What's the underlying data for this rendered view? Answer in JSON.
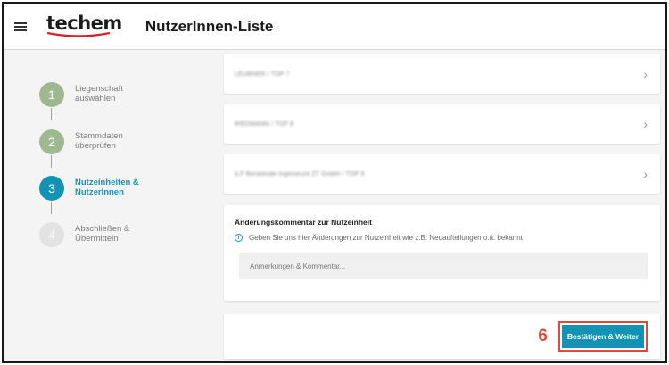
{
  "header": {
    "logo_text": "techem",
    "title": "NutzerInnen-Liste"
  },
  "steps": [
    {
      "number": "1",
      "label": "Liegenschaft auswählen",
      "state": "done"
    },
    {
      "number": "2",
      "label": "Stammdaten überprüfen",
      "state": "done"
    },
    {
      "number": "3",
      "label": "Nutzeinheiten & NutzerInnen",
      "state": "active"
    },
    {
      "number": "4",
      "label": "Abschließen & Übermitteln",
      "state": "todo"
    }
  ],
  "units": [
    {
      "name": "LEUBNER / TOP 7"
    },
    {
      "name": "RIEDMANN / TOP 8"
    },
    {
      "name": "ILF Beratende Ingenieure ZT GmbH / TOP 9"
    }
  ],
  "comment": {
    "title": "Änderungskommentar zur Nutzeinheit",
    "hint": "Geben Sie uns hier Änderungen zur Nutzeinheit wie z.B. Neuaufteilungen o.ä. bekannt",
    "placeholder": "Anmerkungen & Kommentar...",
    "value": ""
  },
  "footer": {
    "annotation_number": "6",
    "confirm_label": "Bestätigen & Weiter"
  },
  "colors": {
    "accent": "#1392b3",
    "done": "#9eb890",
    "annotation": "#e14a3a",
    "brand_red": "#d6232b"
  },
  "icons": {
    "menu": "hamburger-menu-icon",
    "chevron": "chevron-right-icon",
    "info": "info-circle-icon"
  }
}
